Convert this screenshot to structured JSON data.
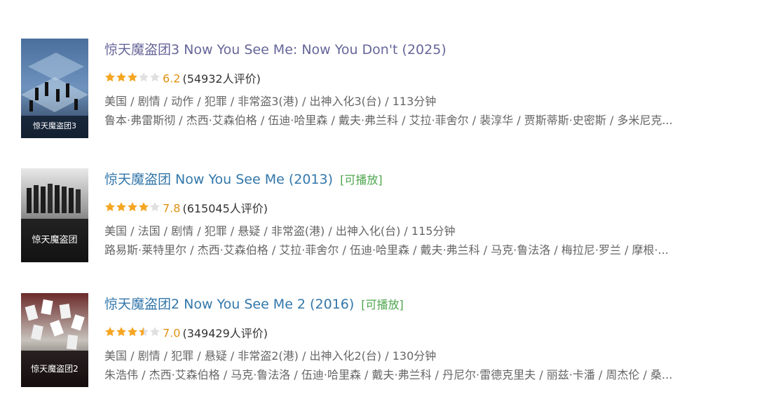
{
  "colors": {
    "link": "#3377aa",
    "visited_link": "#666699",
    "playable": "#4ea54e",
    "score": "#e09015",
    "star_filled": "#f5a623",
    "star_empty": "#e0e0e0",
    "meta_text": "#666666"
  },
  "movies": [
    {
      "title": "惊天魔盗团3 Now You See Me: Now You Don't (2025)",
      "playable": "",
      "stars": 3,
      "score": "6.2",
      "votes": "(54932人评价)",
      "meta": "美国 / 剧情 / 动作 / 犯罪 / 非常盗3(港) / 出神入化3(台) / 113分钟",
      "cast": "鲁本·弗雷斯彻 / 杰西·艾森伯格 / 伍迪·哈里森 / 戴夫·弗兰科 / 艾拉·菲舍尔 / 裴淳华 / 贾斯蒂斯·史密斯 / 多米尼克...",
      "poster_icon": "movie-poster-icon",
      "poster_text": "惊天魔盗团3"
    },
    {
      "title": "惊天魔盗团 Now You See Me (2013)",
      "playable": "[可播放]",
      "stars": 4,
      "score": "7.8",
      "votes": "(615045人评价)",
      "meta": "美国 / 法国 / 剧情 / 犯罪 / 悬疑 / 非常盗(港) / 出神入化(台) / 115分钟",
      "cast": "路易斯·莱特里尔 / 杰西·艾森伯格 / 艾拉·菲舍尔 / 伍迪·哈里森 / 戴夫·弗兰科 / 马克·鲁法洛 / 梅拉尼·罗兰 / 摩根·...",
      "poster_icon": "movie-poster-icon",
      "poster_text": "惊天魔盗团"
    },
    {
      "title": "惊天魔盗团2 Now You See Me 2 (2016)",
      "playable": "[可播放]",
      "stars": 3.5,
      "score": "7.0",
      "votes": "(349429人评价)",
      "meta": "美国 / 剧情 / 犯罪 / 悬疑 / 非常盗2(港) / 出神入化2(台) / 130分钟",
      "cast": "朱浩伟 / 杰西·艾森伯格 / 马克·鲁法洛 / 伍迪·哈里森 / 戴夫·弗兰科 / 丹尼尔·雷德克里夫 / 丽兹·卡潘 / 周杰伦 / 桑...",
      "poster_icon": "movie-poster-icon",
      "poster_text": "惊天魔盗团2"
    }
  ]
}
